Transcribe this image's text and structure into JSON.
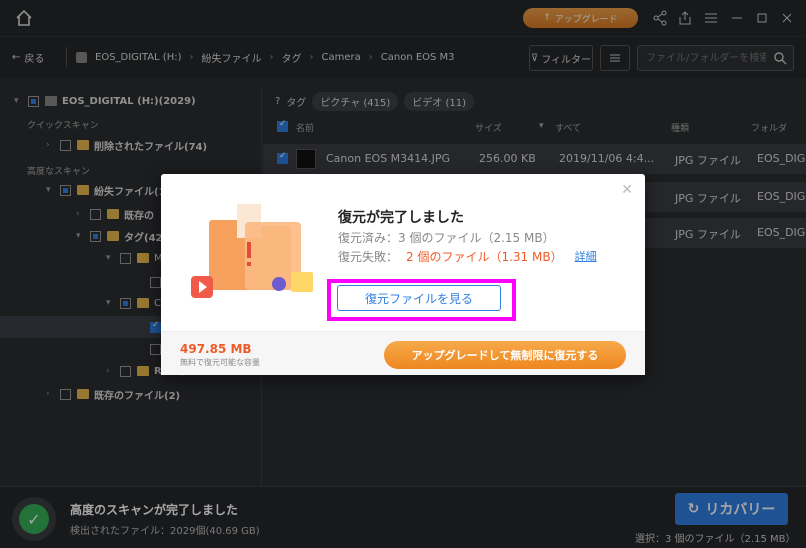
{
  "topbar": {
    "upgrade_label": "アップグレード"
  },
  "navbar": {
    "back_label": "戻る",
    "breadcrumb": [
      "EOS_DIGITAL (H:)",
      "紛失ファイル",
      "タグ",
      "Camera",
      "Canon EOS M3"
    ],
    "filter_label": "フィルター",
    "search_placeholder": "ファイル/フォルダーを検索"
  },
  "sidebar": {
    "drive": "EOS_DIGITAL (H:)(2029)",
    "quick_scan_label": "クイックスキャン",
    "deleted_files": "削除されたファイル(74)",
    "deep_scan_label": "高度なスキャン",
    "lost_files": "紛失ファイル(1",
    "existing_partial": "既存の",
    "tag": "タグ(42",
    "m_item": "M",
    "c_item": "C",
    "raw": "RAW(",
    "existing_files": "既存のファイル(2)"
  },
  "main": {
    "tag_label": "タグ",
    "chips": [
      "ピクチャ (415)",
      "ビデオ (11)"
    ],
    "columns": {
      "name": "名前",
      "size": "サイズ",
      "date": "すべて",
      "type": "種類",
      "folder": "フォルダ"
    },
    "rows": [
      {
        "name": "Canon EOS M3414.JPG",
        "size": "256.00 KB",
        "date": "2019/11/06 4:4...",
        "type": "JPG ファイル",
        "folder": "EOS_DIG"
      },
      {
        "name": "",
        "size": "",
        "date": "",
        "type": "JPG ファイル",
        "folder": "EOS_DIG"
      },
      {
        "name": "",
        "size": "",
        "date": "",
        "type": "JPG ファイル",
        "folder": "EOS_DIG"
      }
    ]
  },
  "bottom": {
    "title": "高度のスキャンが完了しました",
    "subtitle": "検出されたファイル：2029個(40.69 GB)",
    "recover_label": "リカバリー",
    "selected_info": "選択：3 個のファイル（2.15 MB）"
  },
  "dialog": {
    "title": "復元が完了しました",
    "success": "復元済み：3 個のファイル（2.15 MB）",
    "fail_label": "復元失敗：",
    "fail_value": "2 個のファイル（1.31 MB）",
    "detail_link": "詳細",
    "view_button": "復元ファイルを見る",
    "footer_size": "497.85 MB",
    "footer_note": "無料で復元可能な容量",
    "upgrade_button": "アップグレードして無制限に復元する"
  }
}
